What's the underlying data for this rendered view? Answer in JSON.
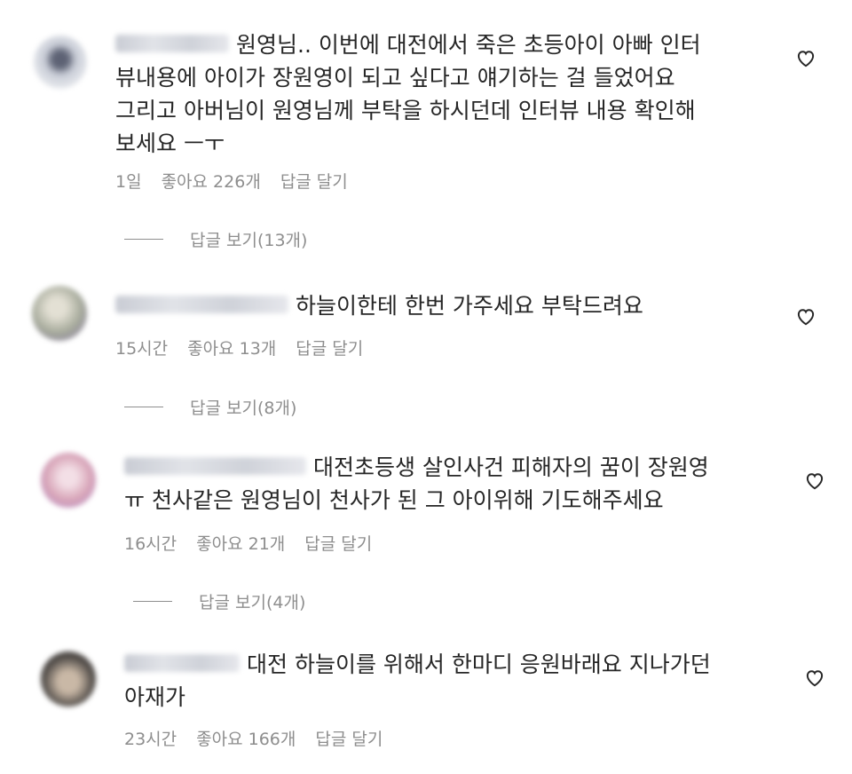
{
  "comments": [
    {
      "text": "원영님.. 이번에 대전에서 죽은 초등아이 아빠 인터\n뷰내용에 아이가 장원영이 되고 싶다고 얘기하는 걸 들었어요\n그리고 아버님이 원영님께 부탁을 하시던데 인터뷰 내용 확인해\n보세요 ㅡㅜ",
      "time": "1일",
      "likes": "좋아요 226개",
      "reply": "답글 달기",
      "view_replies": "답글 보기(13개)",
      "avatar_color": "#9aa0b0"
    },
    {
      "text": "하늘이한테 한번 가주세요 부탁드려요",
      "time": "15시간",
      "likes": "좋아요 13개",
      "reply": "답글 달기",
      "view_replies": "답글 보기(8개)",
      "avatar_color": "#a7ab9c"
    },
    {
      "text": "대전초등생 살인사건 피해자의 꿈이 장원영\nㅠ 천사같은 원영님이 천사가 된 그 아이위해 기도해주세요",
      "time": "16시간",
      "likes": "좋아요 21개",
      "reply": "답글 달기",
      "view_replies": "답글 보기(4개)",
      "avatar_color": "#d8a5b8"
    },
    {
      "text": "대전 하늘이를 위해서 한마디 응원바래요 지나가던\n아재가",
      "time": "23시간",
      "likes": "좋아요 166개",
      "reply": "답글 달기",
      "avatar_color": "#55504c"
    }
  ],
  "icons": {
    "like": "heart-outline-icon"
  }
}
